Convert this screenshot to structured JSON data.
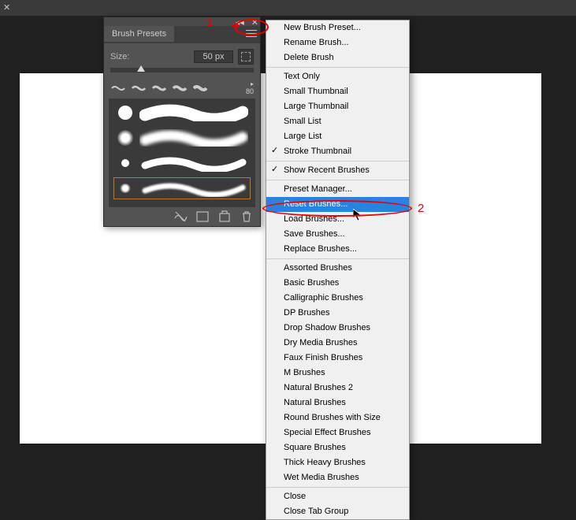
{
  "panel": {
    "tab": "Brush Presets",
    "sizeLabel": "Size:",
    "sizeValue": "50 px",
    "opacityValue": "80"
  },
  "menu": {
    "g1": [
      {
        "l": "New Brush Preset..."
      },
      {
        "l": "Rename Brush..."
      },
      {
        "l": "Delete Brush"
      }
    ],
    "g2": [
      {
        "l": "Text Only"
      },
      {
        "l": "Small Thumbnail"
      },
      {
        "l": "Large Thumbnail"
      },
      {
        "l": "Small List"
      },
      {
        "l": "Large List"
      },
      {
        "l": "Stroke Thumbnail",
        "c": true
      }
    ],
    "g3": [
      {
        "l": "Show Recent Brushes",
        "c": true
      }
    ],
    "g4": [
      {
        "l": "Preset Manager..."
      },
      {
        "l": "Reset Brushes...",
        "hl": true
      },
      {
        "l": "Load Brushes..."
      },
      {
        "l": "Save Brushes..."
      },
      {
        "l": "Replace Brushes..."
      }
    ],
    "g5": [
      {
        "l": "Assorted Brushes"
      },
      {
        "l": "Basic Brushes"
      },
      {
        "l": "Calligraphic Brushes"
      },
      {
        "l": "DP Brushes"
      },
      {
        "l": "Drop Shadow Brushes"
      },
      {
        "l": "Dry Media Brushes"
      },
      {
        "l": "Faux Finish Brushes"
      },
      {
        "l": "M Brushes"
      },
      {
        "l": "Natural Brushes 2"
      },
      {
        "l": "Natural Brushes"
      },
      {
        "l": "Round Brushes with Size"
      },
      {
        "l": "Special Effect Brushes"
      },
      {
        "l": "Square Brushes"
      },
      {
        "l": "Thick Heavy Brushes"
      },
      {
        "l": "Wet Media Brushes"
      }
    ],
    "g6": [
      {
        "l": "Close"
      },
      {
        "l": "Close Tab Group"
      }
    ]
  },
  "labels": {
    "one": "1",
    "two": "2"
  }
}
